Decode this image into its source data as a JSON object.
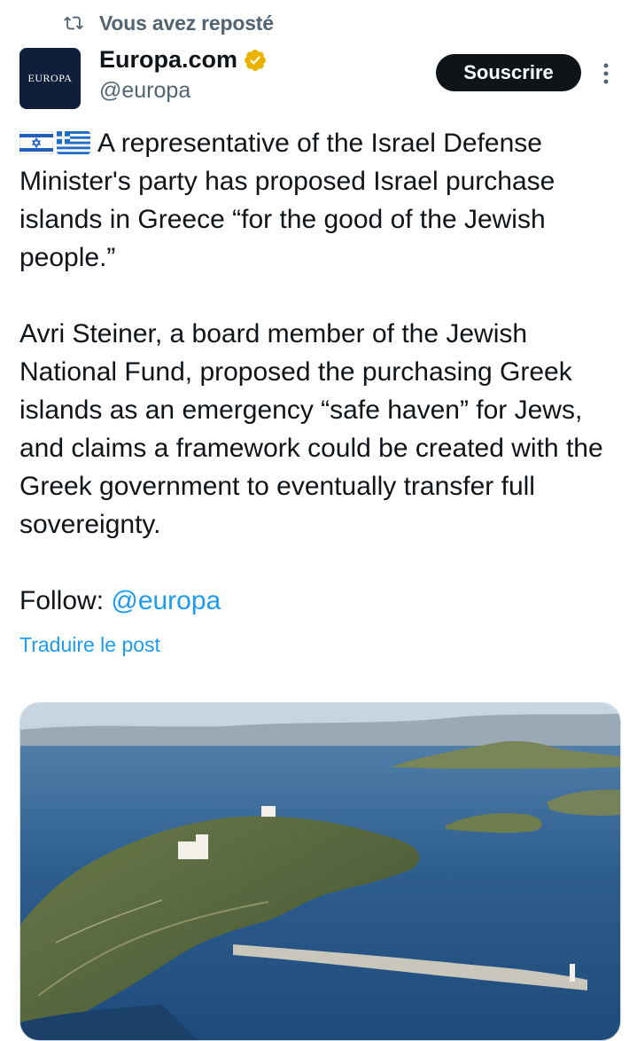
{
  "repost_header": {
    "label": "Vous avez reposté",
    "icon": "repost-icon"
  },
  "author": {
    "avatar_text": "EUROPA",
    "name": "Europa.com",
    "handle": "@europa",
    "verified_badge": "verified-badge-icon",
    "verified_color": "#e8b400"
  },
  "subscribe_button": {
    "label": "Souscrire"
  },
  "post": {
    "flags": [
      "israel-flag-icon",
      "greece-flag-icon"
    ],
    "paragraph_1": "A representative of the Israel Defense Minister's party has proposed Israel purchase islands in Greece “for the good of the Jewish people.”",
    "paragraph_2": "Avri Steiner, a board member of the Jewish National Fund, proposed the purchasing Greek islands as an emergency “safe haven” for Jews, and claims a framework could be created with the Greek government to eventually transfer full sovereignty.",
    "follow_label": "Follow: ",
    "follow_mention": "@europa"
  },
  "translate_link": "Traduire le post",
  "media": {
    "image": "aerial-photo-greek-islands"
  },
  "colors": {
    "link": "#1d9bf0",
    "secondary_text": "#536471",
    "primary_text": "#0f1419",
    "button_bg": "#0f1419"
  }
}
